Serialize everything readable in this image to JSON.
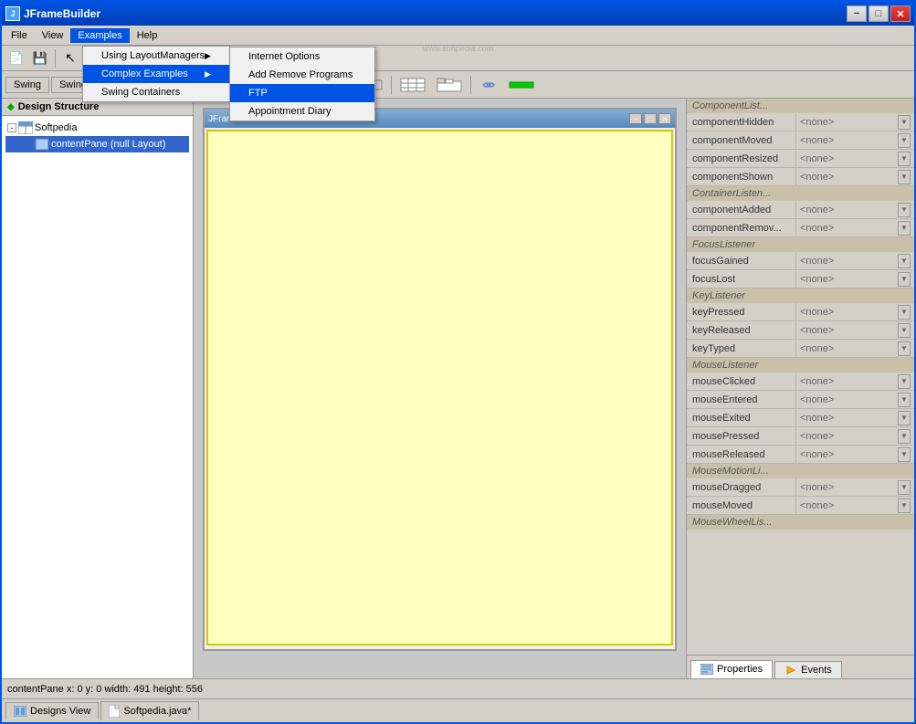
{
  "window": {
    "title": "JFrameBuilder",
    "minimize_label": "−",
    "restore_label": "□",
    "close_label": "✕"
  },
  "softpedia": {
    "watermark": "SOFTPEDIA",
    "url": "www.softpedia.com"
  },
  "menu": {
    "items": [
      {
        "id": "file",
        "label": "File"
      },
      {
        "id": "view",
        "label": "View"
      },
      {
        "id": "examples",
        "label": "Examples"
      },
      {
        "id": "help",
        "label": "Help"
      }
    ]
  },
  "examples_menu": {
    "items": [
      {
        "id": "using-layout",
        "label": "Using LayoutManagers",
        "has_submenu": true
      },
      {
        "id": "complex",
        "label": "Complex Examples",
        "highlighted": true,
        "has_submenu": true
      },
      {
        "id": "swing",
        "label": "Swing Containers",
        "has_submenu": false
      }
    ]
  },
  "complex_submenu": {
    "items": [
      {
        "id": "internet-options",
        "label": "Internet Options"
      },
      {
        "id": "add-remove",
        "label": "Add Remove Programs"
      },
      {
        "id": "ftp",
        "label": "FTP",
        "active": true
      },
      {
        "id": "appointment",
        "label": "Appointment Diary"
      }
    ]
  },
  "toolbar": {
    "buttons": [
      {
        "id": "new",
        "icon": "📄",
        "tooltip": "New"
      },
      {
        "id": "save",
        "icon": "💾",
        "tooltip": "Save"
      }
    ]
  },
  "toolbar2": {
    "tabs": [
      {
        "id": "swing",
        "label": "Swing",
        "active": false
      },
      {
        "id": "swing-containers",
        "label": "Swing Containers",
        "active": false
      }
    ],
    "components": [
      "□",
      "▣",
      "◉",
      "━",
      "▓",
      "label",
      "▬",
      "◻"
    ]
  },
  "design_structure": {
    "header": "Design Structure",
    "tree": [
      {
        "id": "softpedia",
        "label": "Softpedia",
        "icon": "table",
        "expanded": true,
        "children": [
          {
            "id": "content-pane",
            "label": "contentPane (null Layout)",
            "selected": true
          }
        ]
      }
    ]
  },
  "inner_frame": {
    "title": "JFrame - ContentPane",
    "buttons": [
      "−",
      "□",
      "✕"
    ]
  },
  "right_panel": {
    "sections": [
      {
        "id": "component-list",
        "header": "ComponentList...",
        "rows": [
          {
            "name": "componentHidden",
            "value": "<none>"
          },
          {
            "name": "componentMoved",
            "value": "<none>"
          },
          {
            "name": "componentResized",
            "value": "<none>"
          },
          {
            "name": "componentShown",
            "value": "<none>"
          }
        ]
      },
      {
        "id": "container-listener",
        "header": "ContainerListen...",
        "rows": [
          {
            "name": "componentAdded",
            "value": "<none>"
          },
          {
            "name": "componentRemov...",
            "value": "<none>"
          }
        ]
      },
      {
        "id": "focus-listener",
        "header": "FocusListener",
        "rows": [
          {
            "name": "focusGained",
            "value": "<none>"
          },
          {
            "name": "focusLost",
            "value": "<none>"
          }
        ]
      },
      {
        "id": "key-listener",
        "header": "KeyListener",
        "rows": [
          {
            "name": "keyPressed",
            "value": "<none>"
          },
          {
            "name": "keyReleased",
            "value": "<none>"
          },
          {
            "name": "keyTyped",
            "value": "<none>"
          }
        ]
      },
      {
        "id": "mouse-listener",
        "header": "MouseListener",
        "rows": [
          {
            "name": "mouseClicked",
            "value": "<none>"
          },
          {
            "name": "mouseEntered",
            "value": "<none>"
          },
          {
            "name": "mouseExited",
            "value": "<none>"
          },
          {
            "name": "mousePressed",
            "value": "<none>"
          },
          {
            "name": "mouseReleased",
            "value": "<none>"
          }
        ]
      },
      {
        "id": "mouse-motion",
        "header": "MouseMotionLi...",
        "rows": [
          {
            "name": "mouseDragged",
            "value": "<none>"
          },
          {
            "name": "mouseMoved",
            "value": "<none>"
          }
        ]
      },
      {
        "id": "mouse-wheel",
        "header": "MouseWheelLis...",
        "rows": []
      }
    ]
  },
  "bottom_tabs": {
    "designs_view": "Designs View",
    "java_file": "Softpedia.java*"
  },
  "status_bar": {
    "text": "contentPane x: 0 y: 0 width: 491 height: 556"
  }
}
